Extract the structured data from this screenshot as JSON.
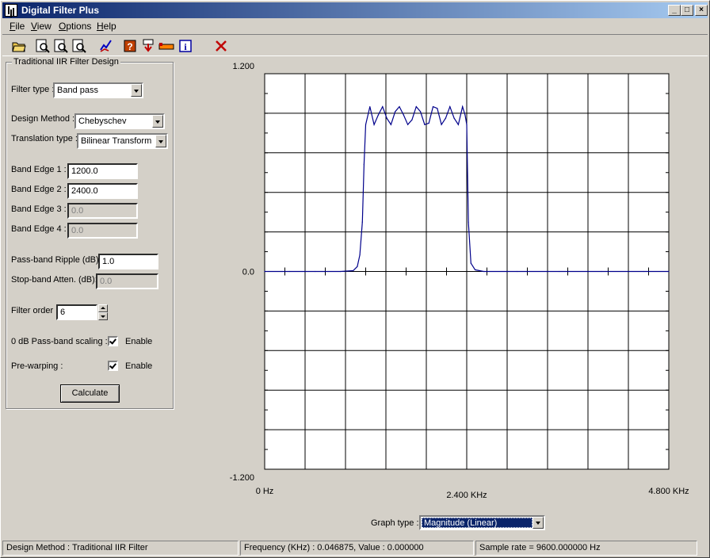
{
  "window": {
    "title": "Digital Filter Plus"
  },
  "menu": [
    {
      "label": "File",
      "u": "F",
      "rest": "ile"
    },
    {
      "label": "View",
      "u": "V",
      "rest": "iew"
    },
    {
      "label": "Options",
      "u": "O",
      "rest": "ptions"
    },
    {
      "label": "Help",
      "u": "H",
      "rest": "elp"
    }
  ],
  "toolbar": {
    "icons": [
      "open-icon",
      "zoom-in-icon",
      "zoom-out-icon",
      "zoom-fit-icon",
      "graph-icon",
      "help-icon",
      "download-icon",
      "ruler-icon",
      "info-icon",
      "close-icon"
    ]
  },
  "panel": {
    "title": "Traditional IIR Filter Design",
    "filter_type_label": "Filter type :",
    "filter_type_value": "Band pass",
    "design_method_label": "Design Method :",
    "design_method_value": "Chebyschev",
    "translation_type_label": "Translation type :",
    "translation_type_value": "Bilinear Transform",
    "band_edge_1_label": "Band Edge 1 :",
    "band_edge_1_value": "1200.0",
    "band_edge_2_label": "Band Edge 2 :",
    "band_edge_2_value": "2400.0",
    "band_edge_3_label": "Band Edge 3 :",
    "band_edge_3_value": "0.0",
    "band_edge_4_label": "Band Edge 4 :",
    "band_edge_4_value": "0.0",
    "passband_ripple_label": "Pass-band Ripple (dB):",
    "passband_ripple_value": "1.0",
    "stopband_atten_label": "Stop-band Atten. (dB):",
    "stopband_atten_value": "0.0",
    "filter_order_label": "Filter order :",
    "filter_order_value": "6",
    "scaling_label": "0 dB Pass-band scaling :",
    "scaling_checkbox_label": "Enable",
    "prewarping_label": "Pre-warping :",
    "prewarping_checkbox_label": "Enable",
    "calculate_label": "Calculate"
  },
  "graph": {
    "graph_type_label": "Graph type :",
    "graph_type_value": "Magnitude (Linear)"
  },
  "chart_data": {
    "type": "line",
    "title": "",
    "xlabel": "",
    "ylabel": "",
    "xlim": [
      0,
      4.8
    ],
    "ylim": [
      -1.2,
      1.2
    ],
    "y_tick_labels": [
      "1.200",
      "0.0",
      "-1.200"
    ],
    "x_tick_labels": [
      "0 Hz",
      "2.400 KHz",
      "4.800 KHz"
    ],
    "grid": true,
    "series": [
      {
        "color": "#00008b",
        "x": [
          0.0,
          0.3,
          0.6,
          0.9,
          1.05,
          1.1,
          1.13,
          1.16,
          1.18,
          1.2,
          1.25,
          1.3,
          1.35,
          1.4,
          1.45,
          1.5,
          1.55,
          1.6,
          1.65,
          1.7,
          1.75,
          1.8,
          1.85,
          1.9,
          1.95,
          2.0,
          2.05,
          2.1,
          2.15,
          2.2,
          2.25,
          2.3,
          2.35,
          2.38,
          2.4,
          2.42,
          2.45,
          2.5,
          2.6,
          3.0,
          3.5,
          4.0,
          4.5,
          4.8
        ],
        "y": [
          0.0,
          0.0,
          0.0,
          0.0,
          0.005,
          0.03,
          0.1,
          0.3,
          0.65,
          0.891,
          1.0,
          0.891,
          0.95,
          1.0,
          0.93,
          0.891,
          0.97,
          1.0,
          0.95,
          0.891,
          0.92,
          1.0,
          0.97,
          0.891,
          0.9,
          1.0,
          0.99,
          0.891,
          0.93,
          1.0,
          0.93,
          0.891,
          1.0,
          0.95,
          0.891,
          0.3,
          0.05,
          0.01,
          0.0,
          0.0,
          0.0,
          0.0,
          0.0,
          0.0
        ]
      }
    ]
  },
  "statusbar": {
    "design_method": "Design Method : Traditional IIR Filter",
    "frequency": "Frequency (KHz) : 0.046875, Value : 0.000000",
    "sample_rate": "Sample rate = 9600.000000 Hz"
  }
}
